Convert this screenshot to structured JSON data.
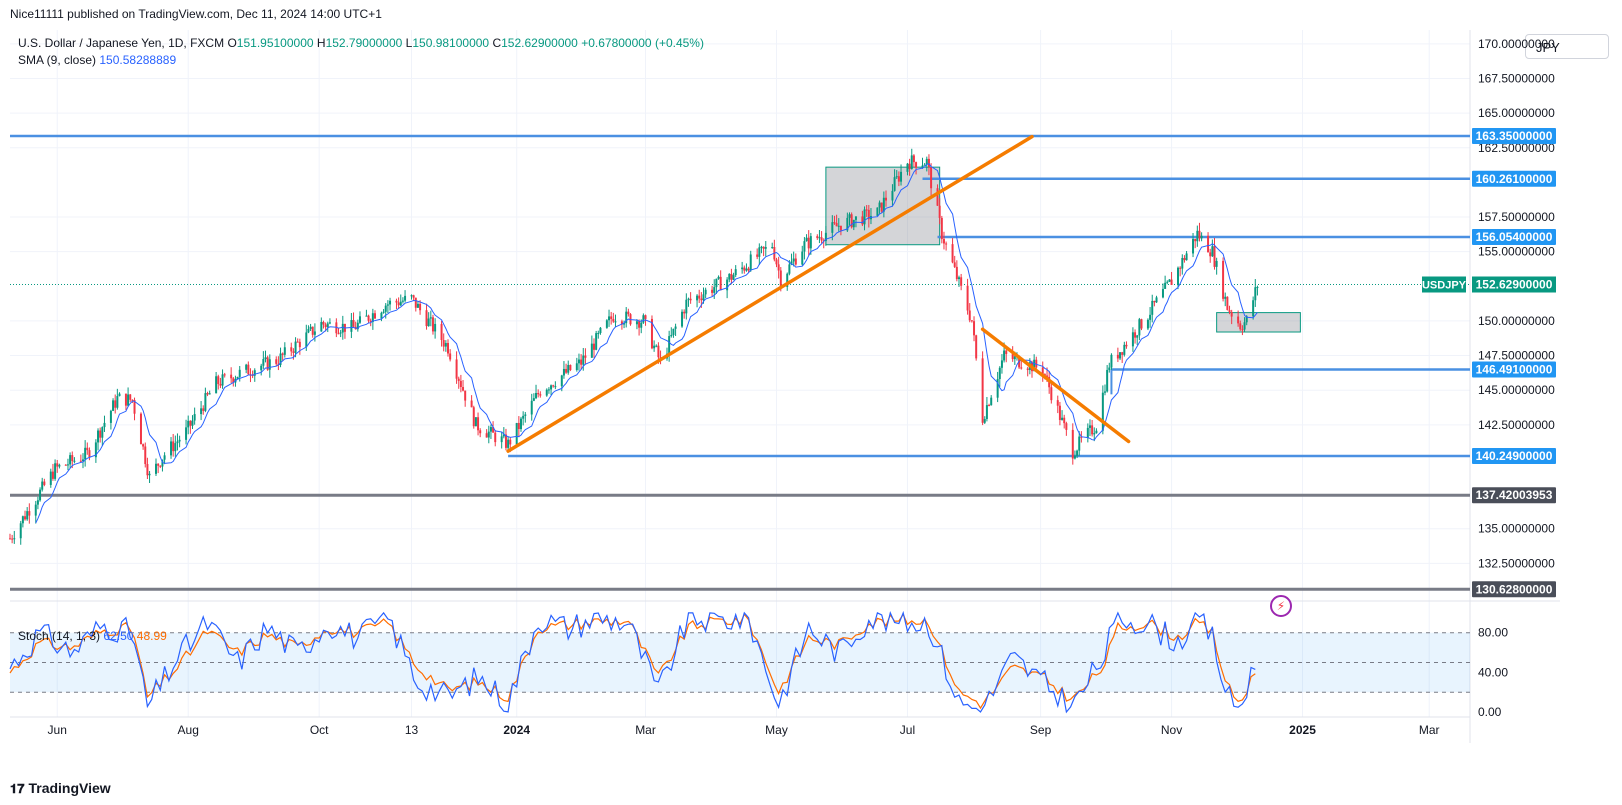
{
  "header": {
    "published": "Nice11111 published on TradingView.com, Dec 11, 2024 14:00 UTC+1"
  },
  "legend": {
    "symbol": "U.S. Dollar / Japanese Yen, 1D, FXCM",
    "o_label": "O",
    "o_value": "151.95100000",
    "h_label": "H",
    "h_value": "152.79000000",
    "l_label": "L",
    "l_value": "150.98100000",
    "c_label": "C",
    "c_value": "152.62900000",
    "change": "+0.67800000 (+0.45%)",
    "sma_label": "SMA (9, close)",
    "sma_value": "150.58288889"
  },
  "stoch_legend": {
    "label": "Stoch (14, 1, 3)",
    "k_value": "62.50",
    "d_value": "48.99"
  },
  "currency_selector": "JPY",
  "footer": {
    "brand": "TradingView",
    "icon": "tradingview-logo-icon"
  },
  "colors": {
    "up": "#089981",
    "down": "#f23645",
    "sma": "#2962ff",
    "hline": "#4a90e2",
    "trendline": "#f57c00",
    "gray_line": "#787b86",
    "stoch_k": "#2962ff",
    "stoch_d": "#ff6d00"
  },
  "chart_data": {
    "type": "candlestick",
    "symbol": "USDJPY",
    "timeframe": "1D",
    "ylim": [
      130.0,
      171.0
    ],
    "y_ticks": [
      "170.00000000",
      "167.50000000",
      "165.00000000",
      "162.50000000",
      "157.50000000",
      "155.00000000",
      "150.00000000",
      "147.50000000",
      "145.00000000",
      "142.50000000",
      "135.00000000",
      "132.50000000"
    ],
    "x_ticks": [
      "Jun",
      "Aug",
      "Oct",
      "13",
      "2024",
      "Mar",
      "May",
      "Jul",
      "Sep",
      "Nov",
      "2025",
      "Mar"
    ],
    "price_levels": [
      {
        "label": "163.35000000",
        "value": 163.35,
        "style": "blue"
      },
      {
        "label": "160.26100000",
        "value": 160.261,
        "style": "blue"
      },
      {
        "label": "156.05400000",
        "value": 156.054,
        "style": "blue"
      },
      {
        "label": "146.49100000",
        "value": 146.491,
        "style": "blue"
      },
      {
        "label": "140.24900000",
        "value": 140.249,
        "style": "blue"
      },
      {
        "label": "137.42003953",
        "value": 137.42003953,
        "style": "gray"
      },
      {
        "label": "130.62800000",
        "value": 130.628,
        "style": "gray"
      }
    ],
    "current_price": {
      "symbol": "USDJPY",
      "value": "152.62900000",
      "price": 152.629
    },
    "trendlines": [
      {
        "from": [
          "2023-12-28",
          140.6
        ],
        "to": [
          "2024-08-28",
          163.3
        ]
      },
      {
        "from": [
          "2024-08-05",
          149.4
        ],
        "to": [
          "2024-10-12",
          141.3
        ]
      }
    ],
    "zones": [
      {
        "from": [
          "2024-05-24",
          161.1
        ],
        "to": [
          "2024-07-16",
          155.5
        ]
      },
      {
        "from": [
          "2024-11-22",
          150.6
        ],
        "to": [
          "2024-12-31",
          149.2
        ]
      }
    ],
    "price_path": [
      [
        "2023-05-10",
        134.3
      ],
      [
        "2023-05-31",
        139.3
      ],
      [
        "2023-06-15",
        140.4
      ],
      [
        "2023-06-29",
        144.4
      ],
      [
        "2023-07-06",
        144.3
      ],
      [
        "2023-07-14",
        138.7
      ],
      [
        "2023-07-20",
        140.2
      ],
      [
        "2023-07-31",
        142.0
      ],
      [
        "2023-08-14",
        145.5
      ],
      [
        "2023-08-28",
        146.4
      ],
      [
        "2023-09-12",
        147.2
      ],
      [
        "2023-10-02",
        149.8
      ],
      [
        "2023-10-17",
        149.5
      ],
      [
        "2023-11-01",
        151.2
      ],
      [
        "2023-11-13",
        151.6
      ],
      [
        "2023-11-30",
        148.1
      ],
      [
        "2023-12-13",
        142.5
      ],
      [
        "2023-12-28",
        141.1
      ],
      [
        "2024-01-12",
        145.0
      ],
      [
        "2024-01-31",
        147.0
      ],
      [
        "2024-02-15",
        150.4
      ],
      [
        "2024-02-29",
        150.0
      ],
      [
        "2024-03-08",
        147.0
      ],
      [
        "2024-03-20",
        151.3
      ],
      [
        "2024-04-10",
        153.2
      ],
      [
        "2024-04-29",
        155.5
      ],
      [
        "2024-05-03",
        153.0
      ],
      [
        "2024-05-14",
        155.5
      ],
      [
        "2024-05-31",
        157.0
      ],
      [
        "2024-06-17",
        157.8
      ],
      [
        "2024-07-01",
        161.5
      ],
      [
        "2024-07-10",
        161.5
      ],
      [
        "2024-07-17",
        156.3
      ],
      [
        "2024-07-31",
        150.0
      ],
      [
        "2024-08-05",
        143.0
      ],
      [
        "2024-08-15",
        147.5
      ],
      [
        "2024-09-02",
        146.5
      ],
      [
        "2024-09-16",
        140.6
      ],
      [
        "2024-09-27",
        142.5
      ],
      [
        "2024-10-03",
        146.9
      ],
      [
        "2024-10-18",
        149.8
      ],
      [
        "2024-11-01",
        152.9
      ],
      [
        "2024-11-13",
        156.3
      ],
      [
        "2024-11-20",
        155.0
      ],
      [
        "2024-11-27",
        151.0
      ],
      [
        "2024-12-03",
        149.7
      ],
      [
        "2024-12-06",
        150.0
      ],
      [
        "2024-12-11",
        152.6
      ]
    ],
    "stochastic": {
      "name": "Stoch (14, 1, 3)",
      "k": 62.5,
      "d": 48.99,
      "upper_band": 80,
      "lower_band": 20,
      "ylim": [
        -5,
        110
      ],
      "y_ticks": [
        "80.00",
        "40.00",
        "0.00"
      ],
      "k_path": [
        [
          "2023-05-10",
          45
        ],
        [
          "2023-05-24",
          80
        ],
        [
          "2023-06-08",
          60
        ],
        [
          "2023-06-22",
          88
        ],
        [
          "2023-07-06",
          80
        ],
        [
          "2023-07-13",
          5
        ],
        [
          "2023-07-27",
          55
        ],
        [
          "2023-08-10",
          90
        ],
        [
          "2023-08-24",
          50
        ],
        [
          "2023-09-07",
          85
        ],
        [
          "2023-09-21",
          60
        ],
        [
          "2023-10-05",
          90
        ],
        [
          "2023-10-19",
          75
        ],
        [
          "2023-11-02",
          95
        ],
        [
          "2023-11-16",
          30
        ],
        [
          "2023-11-30",
          15
        ],
        [
          "2023-12-14",
          35
        ],
        [
          "2023-12-28",
          10
        ],
        [
          "2024-01-11",
          95
        ],
        [
          "2024-01-25",
          85
        ],
        [
          "2024-02-08",
          95
        ],
        [
          "2024-02-22",
          90
        ],
        [
          "2024-03-07",
          20
        ],
        [
          "2024-03-21",
          95
        ],
        [
          "2024-04-04",
          92
        ],
        [
          "2024-04-18",
          95
        ],
        [
          "2024-05-02",
          8
        ],
        [
          "2024-05-16",
          85
        ],
        [
          "2024-05-30",
          60
        ],
        [
          "2024-06-13",
          95
        ],
        [
          "2024-06-27",
          92
        ],
        [
          "2024-07-11",
          90
        ],
        [
          "2024-07-25",
          10
        ],
        [
          "2024-08-05",
          2
        ],
        [
          "2024-08-19",
          55
        ],
        [
          "2024-09-02",
          30
        ],
        [
          "2024-09-16",
          5
        ],
        [
          "2024-09-30",
          55
        ],
        [
          "2024-10-07",
          95
        ],
        [
          "2024-10-21",
          90
        ],
        [
          "2024-11-04",
          70
        ],
        [
          "2024-11-13",
          95
        ],
        [
          "2024-11-20",
          75
        ],
        [
          "2024-11-27",
          15
        ],
        [
          "2024-12-03",
          3
        ],
        [
          "2024-12-11",
          62.5
        ]
      ],
      "d_path": [
        [
          "2023-05-10",
          40
        ],
        [
          "2023-05-24",
          70
        ],
        [
          "2023-06-08",
          65
        ],
        [
          "2023-06-22",
          82
        ],
        [
          "2023-07-06",
          85
        ],
        [
          "2023-07-13",
          15
        ],
        [
          "2023-07-27",
          45
        ],
        [
          "2023-08-10",
          82
        ],
        [
          "2023-08-24",
          60
        ],
        [
          "2023-09-07",
          78
        ],
        [
          "2023-09-21",
          65
        ],
        [
          "2023-10-05",
          85
        ],
        [
          "2023-10-19",
          80
        ],
        [
          "2023-11-02",
          90
        ],
        [
          "2023-11-16",
          45
        ],
        [
          "2023-11-30",
          22
        ],
        [
          "2023-12-14",
          30
        ],
        [
          "2023-12-28",
          15
        ],
        [
          "2024-01-11",
          85
        ],
        [
          "2024-01-25",
          88
        ],
        [
          "2024-02-08",
          92
        ],
        [
          "2024-02-22",
          92
        ],
        [
          "2024-03-07",
          35
        ],
        [
          "2024-03-21",
          85
        ],
        [
          "2024-04-04",
          92
        ],
        [
          "2024-04-18",
          93
        ],
        [
          "2024-05-02",
          20
        ],
        [
          "2024-05-16",
          75
        ],
        [
          "2024-05-30",
          68
        ],
        [
          "2024-06-13",
          90
        ],
        [
          "2024-06-27",
          93
        ],
        [
          "2024-07-11",
          92
        ],
        [
          "2024-07-25",
          20
        ],
        [
          "2024-08-05",
          8
        ],
        [
          "2024-08-19",
          45
        ],
        [
          "2024-09-02",
          35
        ],
        [
          "2024-09-16",
          12
        ],
        [
          "2024-09-30",
          45
        ],
        [
          "2024-10-07",
          85
        ],
        [
          "2024-10-21",
          90
        ],
        [
          "2024-11-04",
          75
        ],
        [
          "2024-11-13",
          90
        ],
        [
          "2024-11-20",
          80
        ],
        [
          "2024-11-27",
          25
        ],
        [
          "2024-12-03",
          8
        ],
        [
          "2024-12-11",
          48.99
        ]
      ]
    }
  }
}
